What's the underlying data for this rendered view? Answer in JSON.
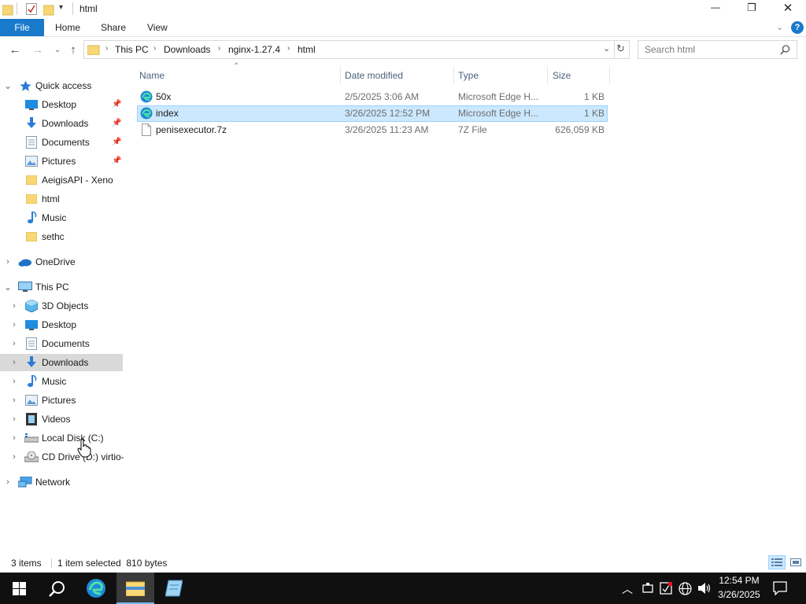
{
  "window": {
    "title": "html",
    "controls": {
      "minimize": "—",
      "maximize": "❐",
      "close": "✕"
    }
  },
  "ribbon": {
    "tabs": [
      "File",
      "Home",
      "Share",
      "View"
    ],
    "help": "?"
  },
  "address": {
    "crumbs": [
      "This PC",
      "Downloads",
      "nginx-1.27.4",
      "html"
    ],
    "search_placeholder": "Search html"
  },
  "nav": {
    "quick_access": "Quick access",
    "quick_items": [
      {
        "label": "Desktop",
        "icon": "desktop-icon",
        "pinned": true
      },
      {
        "label": "Downloads",
        "icon": "downloads-icon",
        "pinned": true
      },
      {
        "label": "Documents",
        "icon": "documents-icon",
        "pinned": true
      },
      {
        "label": "Pictures",
        "icon": "pictures-icon",
        "pinned": true
      },
      {
        "label": "AeigisAPI - Xeno",
        "icon": "folder-icon",
        "pinned": false
      },
      {
        "label": "html",
        "icon": "folder-icon",
        "pinned": false
      },
      {
        "label": "Music",
        "icon": "music-icon",
        "pinned": false
      },
      {
        "label": "sethc",
        "icon": "folder-icon",
        "pinned": false
      }
    ],
    "onedrive": "OneDrive",
    "this_pc": "This PC",
    "pc_items": [
      {
        "label": "3D Objects",
        "icon": "3d-objects-icon"
      },
      {
        "label": "Desktop",
        "icon": "desktop-icon"
      },
      {
        "label": "Documents",
        "icon": "documents-icon"
      },
      {
        "label": "Downloads",
        "icon": "downloads-icon"
      },
      {
        "label": "Music",
        "icon": "music-icon"
      },
      {
        "label": "Pictures",
        "icon": "pictures-icon"
      },
      {
        "label": "Videos",
        "icon": "videos-icon"
      },
      {
        "label": "Local Disk (C:)",
        "icon": "local-disk-icon"
      },
      {
        "label": "CD Drive (D:) virtio-",
        "icon": "cd-drive-icon"
      }
    ],
    "network": "Network"
  },
  "files": {
    "columns": [
      "Name",
      "Date modified",
      "Type",
      "Size"
    ],
    "rows": [
      {
        "name": "50x",
        "date": "2/5/2025 3:06 AM",
        "type": "Microsoft Edge H...",
        "size": "1 KB",
        "icon": "edge-html-icon",
        "selected": false
      },
      {
        "name": "index",
        "date": "3/26/2025 12:52 PM",
        "type": "Microsoft Edge H...",
        "size": "1 KB",
        "icon": "edge-html-icon",
        "selected": true
      },
      {
        "name": "penisexecutor.7z",
        "date": "3/26/2025 11:23 AM",
        "type": "7Z File",
        "size": "626,059 KB",
        "icon": "file-icon",
        "selected": false
      }
    ]
  },
  "status": {
    "items": "3 items",
    "selection": "1 item selected  810 bytes"
  },
  "taskbar": {
    "time": "12:54 PM",
    "date": "3/26/2025"
  },
  "colors": {
    "accent": "#1979ca",
    "selection": "#cce8ff",
    "selection_border": "#99d1ff",
    "nav_hover": "#d9d9d9",
    "folder": "#f8d775",
    "taskbar": "#101010"
  }
}
